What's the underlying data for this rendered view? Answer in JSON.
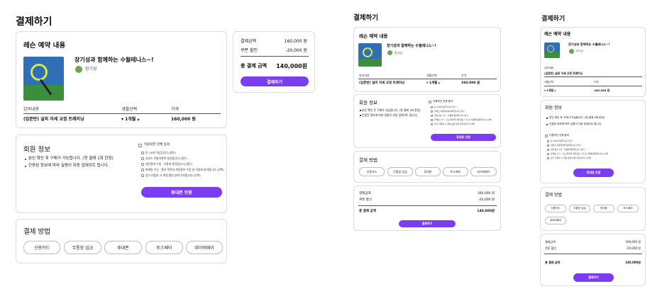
{
  "page_title": "결제하기",
  "lesson": {
    "section_title": "레슨 예약 내용",
    "lesson_name": "장기성과 함께하는 수월테니스~!",
    "instructor": "장기성",
    "col_content": "강의내용",
    "col_months": "개월선택",
    "col_price": "가격",
    "row_content": "(입문반) 실외 자세 교정 트레이닝",
    "row_months": "1개월",
    "row_price": "160,000 원"
  },
  "summary": {
    "amount_label": "결제금액",
    "amount_value": "160,000 원",
    "coupon_label": "쿠폰 할인",
    "coupon_value": "-20,000 원",
    "total_label": "총 결제 금액",
    "total_value": "140,000원",
    "pay_button": "결제하기"
  },
  "member": {
    "section_title": "회원 정보",
    "note1": "본인 확인 후 구매가 가능합니다. (첫 결제 1회 한정)",
    "note2": "인증된 정보에 따라 실명이 자동 업데이트 됩니다.",
    "agree_all": "이용약관 전체 동의",
    "terms": [
      "만 14세 이상입니다.(필수)",
      "서비스 이용약관에 동의합니다.(필수)",
      "개인정보 수집 · 이용에 동의합니다.(필수)",
      "마케팅 수신 · 홍보 목적의 개인정보 수집 및 이용에 동의합니다.(선택)",
      "장기 미접속 시 계정 활성 상태 유지합니다.(선택)"
    ],
    "verify_button": "휴대폰 인증"
  },
  "payment": {
    "section_title": "결제 방법",
    "methods": [
      "신용카드",
      "무통장 입금",
      "휴대폰",
      "토스페이",
      "네이버페이"
    ]
  },
  "colors": {
    "accent": "#7b3cf2",
    "border": "#dcdcdc"
  }
}
